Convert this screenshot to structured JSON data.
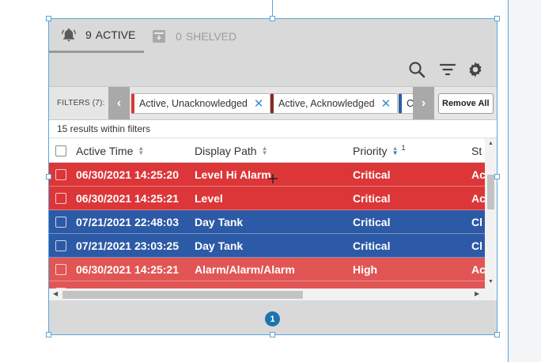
{
  "tabs": {
    "active": {
      "count": "9",
      "label": "ACTIVE",
      "icon": "bell-icon"
    },
    "shelved": {
      "count": "0",
      "label": "SHELVED",
      "icon": "archive-icon"
    }
  },
  "toolbar": {
    "icons": [
      "search-icon",
      "filter-icon",
      "gear-icon"
    ]
  },
  "filters": {
    "label": "FILTERS (7):",
    "chips": [
      {
        "label": "Active, Unacknowledged",
        "color": "#d43a3a"
      },
      {
        "label": "Active, Acknowledged",
        "color": "#8a2a2a"
      },
      {
        "label": "C",
        "color": "#2a5fa8"
      }
    ],
    "remove_all": "Remove All"
  },
  "results_text": "15 results within filters",
  "table": {
    "columns": [
      {
        "label": "Active Time"
      },
      {
        "label": "Display Path"
      },
      {
        "label": "Priority",
        "sort_order": "1"
      },
      {
        "label": "St"
      }
    ],
    "rows": [
      {
        "time": "06/30/2021 14:25:20",
        "path": "Level Hi Alarm",
        "priority": "Critical",
        "state": "Ac",
        "color": "#dc3638"
      },
      {
        "time": "06/30/2021 14:25:21",
        "path": "Level",
        "priority": "Critical",
        "state": "Ac",
        "color": "#dc3638"
      },
      {
        "time": "07/21/2021 22:48:03",
        "path": "Day Tank",
        "priority": "Critical",
        "state": "Cl",
        "color": "#2d5aa6"
      },
      {
        "time": "07/21/2021 23:03:25",
        "path": "Day Tank",
        "priority": "Critical",
        "state": "Cl",
        "color": "#2d5aa6"
      },
      {
        "time": "06/30/2021 14:25:21",
        "path": "Alarm/Alarm/Alarm",
        "priority": "High",
        "state": "Ac",
        "color": "#e25555"
      },
      {
        "time": "",
        "path": "",
        "priority": "",
        "state": "",
        "color": "#e25555"
      }
    ]
  },
  "pager": {
    "current_page": "1"
  }
}
